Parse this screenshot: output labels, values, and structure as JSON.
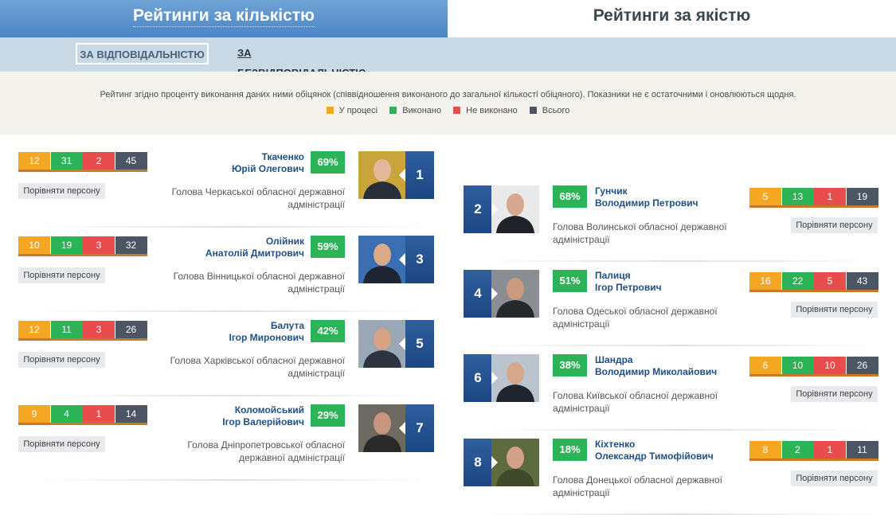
{
  "tabs": {
    "quantity": "Рейтинги за кількістю",
    "quality": "Рейтинги за якістю"
  },
  "subtabs": {
    "responsibility": "ЗА ВІДПОВІДАЛЬНІСТЮ",
    "irresponsibility": "ЗА БЕЗВІДПОВІДАЛЬНІСТЮ"
  },
  "info": {
    "text": "Рейтинг згідно проценту виконання даних ними обіцянок (співвідношення виконаного до загальної кількості обіцяного). Показники не є остаточними і оновлюються щодня.",
    "legend": [
      {
        "label": "У процесі",
        "color": "#f5a623"
      },
      {
        "label": "Виконано",
        "color": "#2db357"
      },
      {
        "label": "Не виконано",
        "color": "#e84c4c"
      },
      {
        "label": "Всього",
        "color": "#4b5563"
      }
    ]
  },
  "compare_label": "Порівняти персону",
  "people": [
    {
      "rank": "1",
      "last_name": "Ткаченко",
      "first_names": "Юрій Олегович",
      "percent": "69%",
      "in_process": "12",
      "done": "31",
      "not_done": "2",
      "total": "45",
      "position_line1": "Голова Черкаської обласної державної",
      "position_line2": "адміністрації",
      "photo_colors": [
        "#c8a43a",
        "#2a2e3a",
        "#e2b79a"
      ]
    },
    {
      "rank": "2",
      "last_name": "Гунчик",
      "first_names": "Володимир Петрович",
      "percent": "68%",
      "in_process": "5",
      "done": "13",
      "not_done": "1",
      "total": "19",
      "position_line1": "Голова Волинської обласної державної",
      "position_line2": "адміністрації",
      "photo_colors": [
        "#e9e9e9",
        "#1f2228",
        "#d6a88d"
      ]
    },
    {
      "rank": "3",
      "last_name": "Олійник",
      "first_names": "Анатолій Дмитрович",
      "percent": "59%",
      "in_process": "10",
      "done": "19",
      "not_done": "3",
      "total": "32",
      "position_line1": "Голова Вінницької обласної державної",
      "position_line2": "адміністрації",
      "photo_colors": [
        "#3a6fb4",
        "#1f2633",
        "#d9a988"
      ]
    },
    {
      "rank": "4",
      "last_name": "Палиця",
      "first_names": "Ігор Петрович",
      "percent": "51%",
      "in_process": "16",
      "done": "22",
      "not_done": "5",
      "total": "43",
      "position_line1": "Голова Одеської обласної державної",
      "position_line2": "адміністрації",
      "photo_colors": [
        "#8a8e93",
        "#26282c",
        "#c99a7e"
      ]
    },
    {
      "rank": "5",
      "last_name": "Балута",
      "first_names": "Ігор Миронович",
      "percent": "42%",
      "in_process": "12",
      "done": "11",
      "not_done": "3",
      "total": "26",
      "position_line1": "Голова Харківської обласної державної",
      "position_line2": "адміністрації",
      "photo_colors": [
        "#9aa7b5",
        "#2c3440",
        "#d8a285"
      ]
    },
    {
      "rank": "6",
      "last_name": "Шандра",
      "first_names": "Володимир Миколайович",
      "percent": "38%",
      "in_process": "6",
      "done": "10",
      "not_done": "10",
      "total": "26",
      "position_line1": "Голова Київської обласної державної",
      "position_line2": "адміністрації",
      "photo_colors": [
        "#b9c4cf",
        "#20242c",
        "#d7a78a"
      ]
    },
    {
      "rank": "7",
      "last_name": "Коломойський",
      "first_names": "Ігор Валерійович",
      "percent": "29%",
      "in_process": "9",
      "done": "4",
      "not_done": "1",
      "total": "14",
      "position_line1": "Голова Дніпропетровської обласної",
      "position_line2": "державної адміністрації",
      "photo_colors": [
        "#6e6a62",
        "#2a2a2a",
        "#c89680"
      ]
    },
    {
      "rank": "8",
      "last_name": "Кіхтенко",
      "first_names": "Олександр Тимофійович",
      "percent": "18%",
      "in_process": "8",
      "done": "2",
      "not_done": "1",
      "total": "11",
      "position_line1": "Голова Донецької обласної державної",
      "position_line2": "адміністрації",
      "photo_colors": [
        "#5e6a3f",
        "#3e4a2a",
        "#d2a187"
      ]
    }
  ]
}
